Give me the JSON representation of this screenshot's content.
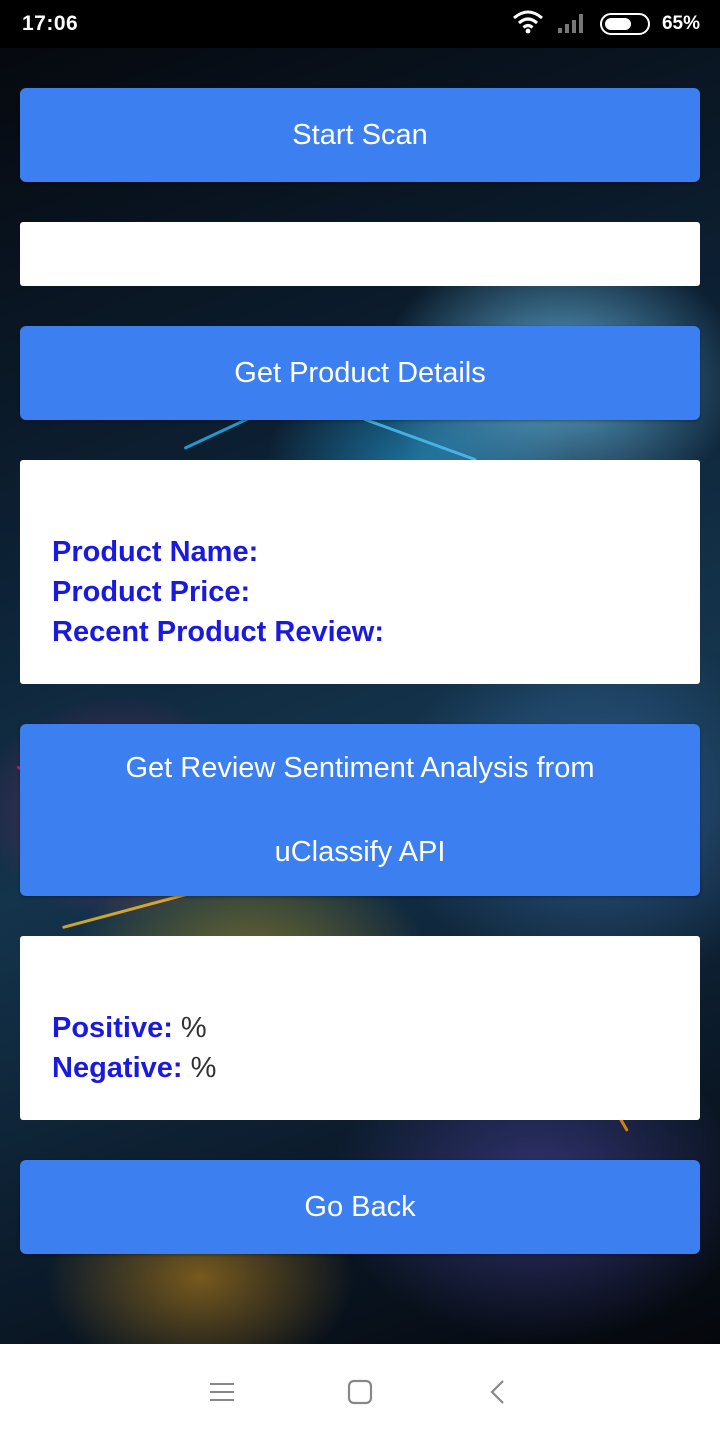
{
  "status_bar": {
    "time": "17:06",
    "battery_percent_label": "65%",
    "battery_level": 0.65,
    "icons": [
      "wifi-icon",
      "signal-icon",
      "battery-icon"
    ]
  },
  "buttons": {
    "start_scan": "Start Scan",
    "get_product_details": "Get Product Details",
    "sentiment_line1": "Get Review Sentiment Analysis from",
    "sentiment_line2": "uClassify API",
    "go_back": "Go Back"
  },
  "barcode_input": {
    "value": "",
    "placeholder": ""
  },
  "product_details": {
    "name_label": "Product Name:",
    "name_value": "",
    "price_label": "Product Price:",
    "price_value": "",
    "review_label": "Recent Product Review:",
    "review_value": ""
  },
  "sentiment": {
    "positive_label": "Positive:",
    "positive_value": " %",
    "negative_label": "Negative:",
    "negative_value": " %"
  },
  "nav_bar": {
    "icons": [
      "menu-icon",
      "home-icon",
      "back-icon"
    ]
  },
  "colors": {
    "button_bg": "#3b7ff0",
    "label_blue": "#1a1adf",
    "card_bg": "#ffffff"
  }
}
